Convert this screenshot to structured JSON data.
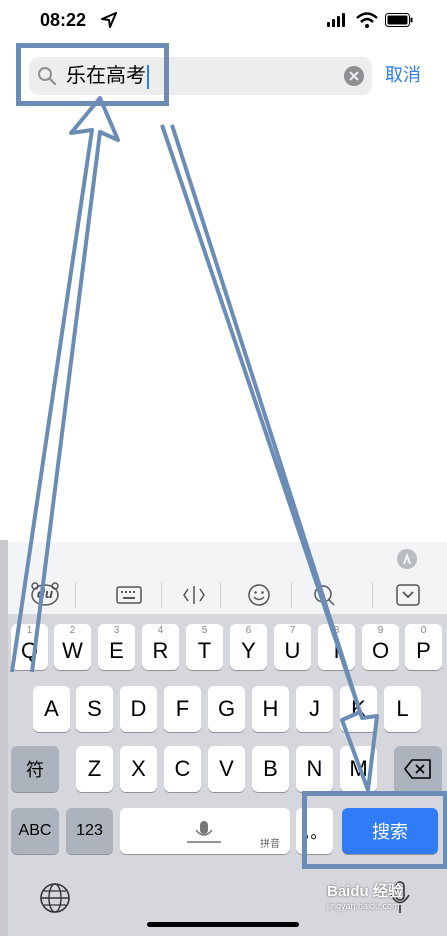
{
  "status_bar": {
    "time": "08:22"
  },
  "search": {
    "query": "乐在高考",
    "cancel_label": "取消"
  },
  "keyboard": {
    "row1": [
      {
        "num": "1",
        "letter": "Q"
      },
      {
        "num": "2",
        "letter": "W"
      },
      {
        "num": "3",
        "letter": "E"
      },
      {
        "num": "4",
        "letter": "R"
      },
      {
        "num": "5",
        "letter": "T"
      },
      {
        "num": "6",
        "letter": "Y"
      },
      {
        "num": "7",
        "letter": "U"
      },
      {
        "num": "8",
        "letter": "I"
      },
      {
        "num": "9",
        "letter": "O"
      },
      {
        "num": "0",
        "letter": "P"
      }
    ],
    "row2": [
      "A",
      "S",
      "D",
      "F",
      "G",
      "H",
      "J",
      "K",
      "L"
    ],
    "row3": [
      "Z",
      "X",
      "C",
      "V",
      "B",
      "N",
      "M"
    ],
    "symbols_label": "符",
    "abc_label": "ABC",
    "num_label": "123",
    "space_label": "拼音",
    "dots_label": "。。",
    "search_label": "搜索",
    "toolbar_logo": "du"
  },
  "watermark": "Baidu 经验",
  "watermark_url": "jingyan.baidu.com",
  "colors": {
    "accent": "#2f7cf6",
    "annotation": "#6b8db5"
  },
  "icons": [
    "location-arrow-icon",
    "signal-icon",
    "wifi-icon",
    "battery-icon",
    "search-icon",
    "clear-icon",
    "keyboard-icon",
    "cursor-icon",
    "emoji-icon",
    "search-toolbar-icon",
    "hide-keyboard-icon",
    "mic-icon",
    "backspace-icon",
    "globe-icon",
    "dictation-icon"
  ]
}
